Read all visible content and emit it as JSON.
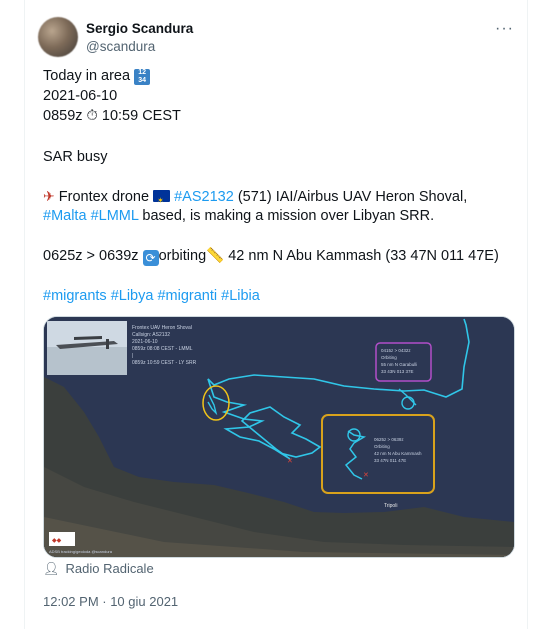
{
  "author": {
    "name": "Sergio Scandura",
    "handle": "@scandura"
  },
  "more_icon": "more-horizontal-icon",
  "tweet": {
    "line1": "Today in area",
    "line1_emoji": "1234",
    "line2": "2021-06-10",
    "line3a": "0859z",
    "line3b": "10:59 CEST",
    "line4": "SAR busy",
    "line5a": "Frontex drone",
    "line5_tag1": "#AS2132",
    "line5b": "(571) IAI/Airbus UAV Heron Shoval,",
    "line6_tag1": "#Malta",
    "line6_tag2": "#LMML",
    "line6b": "based, is making a mission over Libyan SRR.",
    "line7a": "0625z > 0639z",
    "line7b": "orbiting",
    "line7c": "42 nm N Abu Kammash (33 47N 011 47E)",
    "hashtags": [
      "#migrants",
      "#Libya",
      "#migranti",
      "#Libia"
    ]
  },
  "media": {
    "caption": {
      "l1": "Frontex UAV Heron Shoval",
      "l2": "Callsign: AS2132",
      "l3": "2021-06-10",
      "l4": "0859z 08:08 CEST - LMML",
      "l5": "|",
      "l6": "0859z 10:59 CEST - LY SRR"
    },
    "box_purple": {
      "l1": "0415z > 0432z",
      "l2": "Orbiting",
      "l3": "55 nm N Garabulli",
      "l4": "33 43N 013 37E"
    },
    "box_yellow": {
      "l1": "0625z > 0639z",
      "l2": "Orbiting",
      "l3": "42 nm N Abu Kammash",
      "l4": "33 47N 011 47E"
    },
    "city": "Tripoli",
    "credit": "ADSB tracking/geoloda @scandura"
  },
  "source": "Radio Radicale",
  "timestamp": "12:02 PM · 10 giu 2021"
}
